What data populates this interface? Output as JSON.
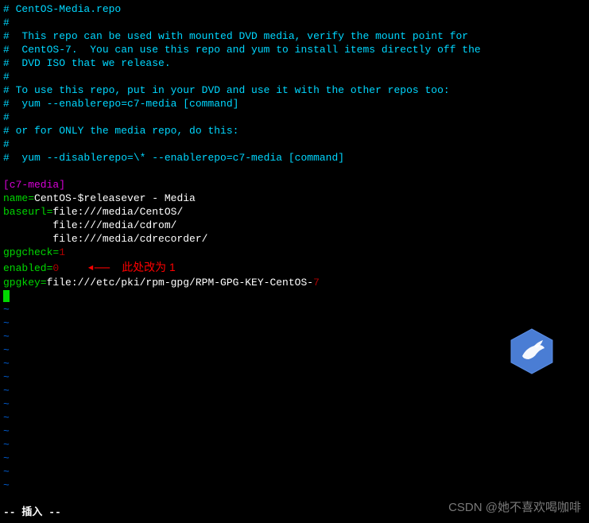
{
  "comments": {
    "l1": "# CentOS-Media.repo",
    "l2": "#",
    "l3": "#  This repo can be used with mounted DVD media, verify the mount point for",
    "l4": "#  CentOS-7.  You can use this repo and yum to install items directly off the",
    "l5": "#  DVD ISO that we release.",
    "l6": "#",
    "l7": "# To use this repo, put in your DVD and use it with the other repos too:",
    "l8": "#  yum --enablerepo=c7-media [command]",
    "l9": "#",
    "l10": "# or for ONLY the media repo, do this:",
    "l11": "#",
    "l12": "#  yum --disablerepo=\\* --enablerepo=c7-media [command]"
  },
  "section": {
    "header": "[c7-media]",
    "name_key": "name=",
    "name_val": "CentOS-$releasever - Media",
    "baseurl_key": "baseurl=",
    "baseurl_val1": "file:///media/CentOS/",
    "baseurl_val2": "        file:///media/cdrom/",
    "baseurl_val3": "        file:///media/cdrecorder/",
    "gpgcheck_key": "gpgcheck=",
    "gpgcheck_val": "1",
    "enabled_key": "enabled=",
    "enabled_val": "0",
    "gpgkey_key": "gpgkey=",
    "gpgkey_val": "file:///etc/pki/rpm-gpg/RPM-GPG-KEY-CentOS-",
    "gpgkey_suffix": "7"
  },
  "annotation": {
    "text": "此处改为 1"
  },
  "tilde": "~",
  "status": "-- 插入 --",
  "watermark": "CSDN @她不喜欢喝咖啡"
}
